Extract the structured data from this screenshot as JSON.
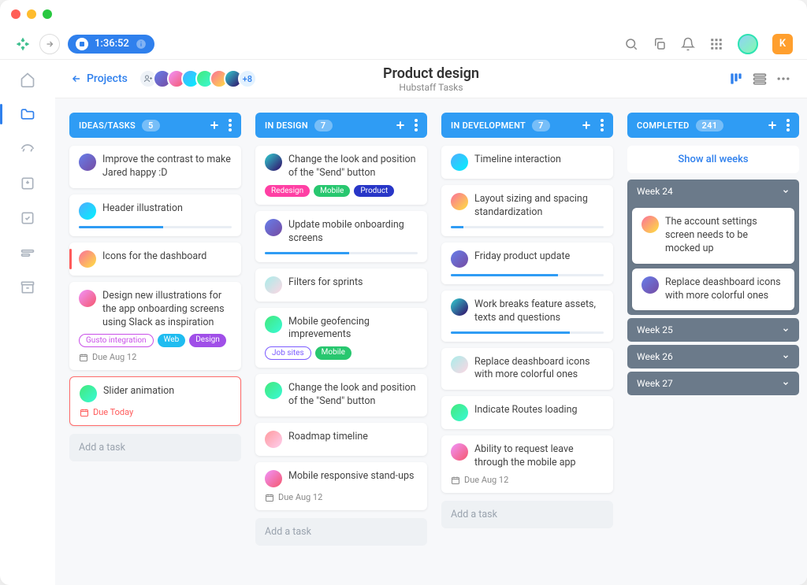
{
  "timer": "1:36:52",
  "user_badge": "K",
  "breadcrumb_back": "Projects",
  "avatar_overflow": "+8",
  "page_title": "Product design",
  "page_subtitle": "Hubstaff Tasks",
  "columns": {
    "ideas": {
      "title": "IDEAS/TASKS",
      "count": "5",
      "add": "Add a task"
    },
    "design": {
      "title": "IN DESIGN",
      "count": "7",
      "add": "Add a task"
    },
    "dev": {
      "title": "IN DEVELOPMENT",
      "count": "7",
      "add": "Add a task"
    },
    "completed": {
      "title": "COMPLETED",
      "count": "241",
      "show_all": "Show all weeks"
    }
  },
  "cards": {
    "ideas": [
      {
        "title": "Improve the contrast to make Jared happy :D"
      },
      {
        "title": "Header illustration",
        "progress": 55
      },
      {
        "title": "Icons for the dashboard",
        "accent": true
      },
      {
        "title": "Design new illustrations for the app onboarding screens using Slack as inspiration",
        "tags": [
          {
            "label": "Gusto integration",
            "color": "#c94fe8",
            "outline": true
          },
          {
            "label": "Web",
            "bg": "#1fbcf0"
          },
          {
            "label": "Design",
            "bg": "#a04fe8"
          }
        ],
        "due": "Due Aug 12"
      },
      {
        "title": "Slider animation",
        "due": "Due Today",
        "red": true
      }
    ],
    "design": [
      {
        "title": "Change the look and position of the \"Send\" button",
        "tags": [
          {
            "label": "Redesign",
            "bg": "#ff3fa4"
          },
          {
            "label": "Mobile",
            "bg": "#28c76f"
          },
          {
            "label": "Product",
            "bg": "#2836c7"
          }
        ]
      },
      {
        "title": "Update mobile onboarding screens",
        "progress": 55
      },
      {
        "title": "Filters for sprints"
      },
      {
        "title": "Mobile geofencing imprevements",
        "tags": [
          {
            "label": "Job sites",
            "color": "#7b5bff",
            "outline": true
          },
          {
            "label": "Mobile",
            "bg": "#28c76f"
          }
        ]
      },
      {
        "title": "Change the look and position of the \"Send\" button"
      },
      {
        "title": "Roadmap timeline"
      },
      {
        "title": "Mobile responsive stand-ups",
        "due": "Due Aug 12"
      }
    ],
    "dev": [
      {
        "title": "Timeline interaction"
      },
      {
        "title": "Layout sizing and spacing standardization",
        "progress": 8
      },
      {
        "title": "Friday product update",
        "progress": 70
      },
      {
        "title": "Work breaks feature assets, texts and questions",
        "progress": 78
      },
      {
        "title": "Replace deashboard icons with more colorful ones"
      },
      {
        "title": "Indicate Routes loading"
      },
      {
        "title": "Ability to request leave through the mobile app",
        "due": "Due Aug 12"
      }
    ],
    "completed_weeks": [
      {
        "label": "Week 24",
        "expanded": true,
        "cards": [
          {
            "title": "The account settings screen needs to be mocked up"
          },
          {
            "title": "Replace deashboard icons with more colorful ones"
          }
        ]
      },
      {
        "label": "Week 25"
      },
      {
        "label": "Week 26"
      },
      {
        "label": "Week 27"
      }
    ]
  }
}
